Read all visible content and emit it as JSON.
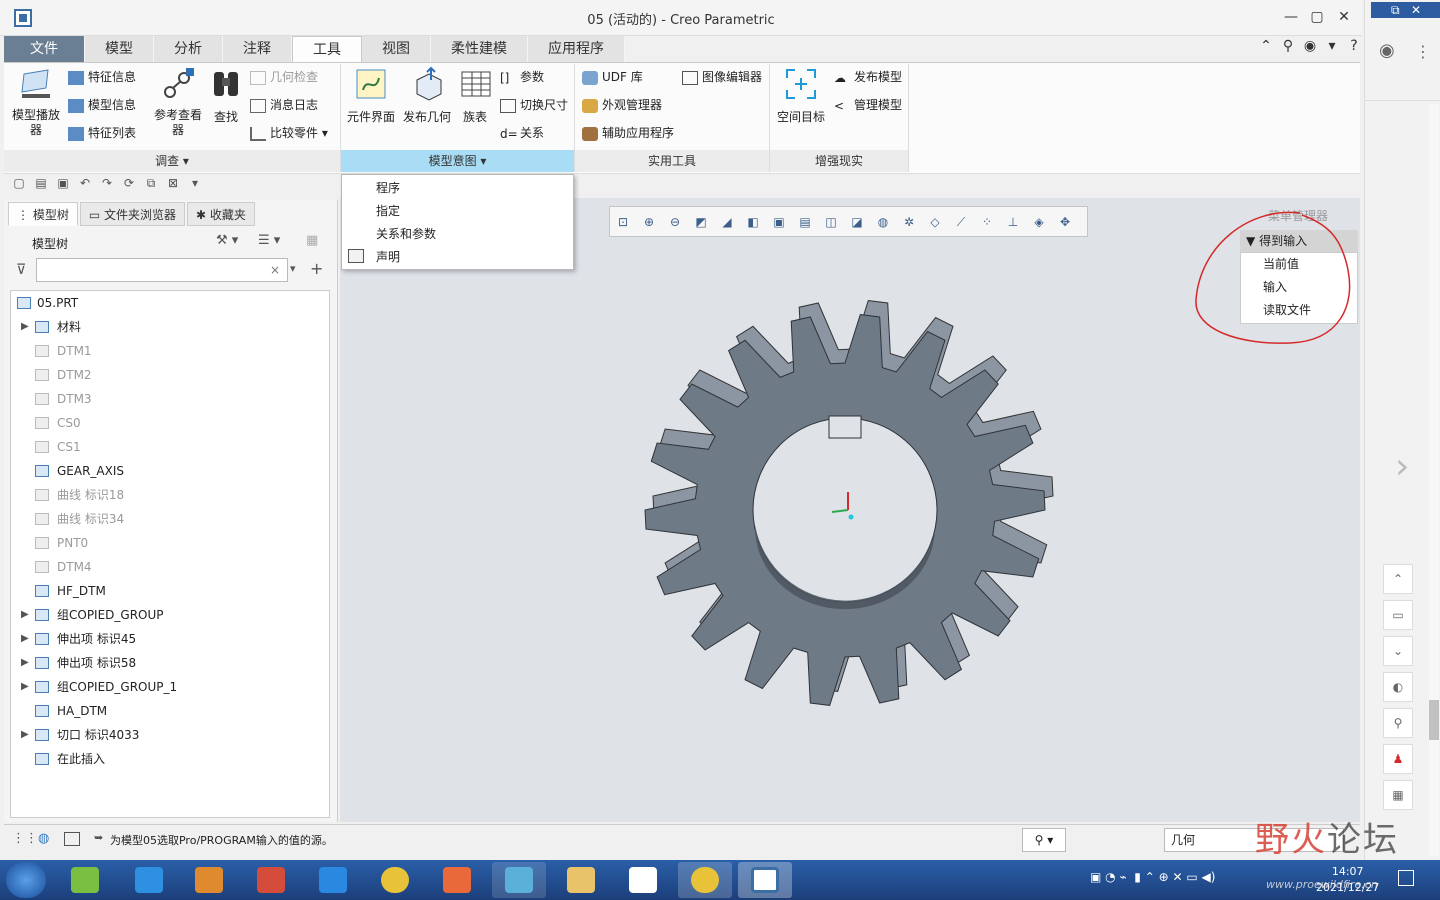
{
  "window": {
    "title": "05 (活动的) - Creo Parametric",
    "controls": [
      "minimize",
      "maximize",
      "close"
    ]
  },
  "menu_tabs": [
    "文件",
    "模型",
    "分析",
    "注释",
    "工具",
    "视图",
    "柔性建模",
    "应用程序"
  ],
  "active_tab": "工具",
  "ribbon": {
    "investigate": {
      "label": "调查",
      "big": [
        "模型播放器",
        "参考查看器",
        "查找"
      ],
      "small": [
        "特征信息",
        "模型信息",
        "特征列表",
        "几何检查",
        "消息日志",
        "比较零件"
      ]
    },
    "model_intent": {
      "label": "模型意图",
      "big": [
        "元件界面",
        "发布几何",
        "族表"
      ],
      "small": [
        "参数",
        "切换尺寸",
        "关系"
      ]
    },
    "utilities": {
      "label": "实用工具",
      "small": [
        "UDF 库",
        "外观管理器",
        "辅助应用程序",
        "图像编辑器"
      ]
    },
    "ar": {
      "label": "增强现实",
      "big": [
        "空间目标"
      ],
      "small": [
        "发布模型",
        "管理模型"
      ]
    }
  },
  "dropdown": {
    "items": [
      "程序",
      "指定",
      "关系和参数",
      "声明"
    ]
  },
  "panel_tabs": [
    "模型树",
    "文件夹浏览器",
    "收藏夹"
  ],
  "model_tree": {
    "header": "模型树",
    "filter_placeholder": "",
    "items": [
      {
        "label": "05.PRT",
        "dim": false,
        "expand": false,
        "indent": 0
      },
      {
        "label": "材料",
        "dim": false,
        "expand": true,
        "indent": 1
      },
      {
        "label": "DTM1",
        "dim": true,
        "expand": false,
        "indent": 1
      },
      {
        "label": "DTM2",
        "dim": true,
        "expand": false,
        "indent": 1
      },
      {
        "label": "DTM3",
        "dim": true,
        "expand": false,
        "indent": 1
      },
      {
        "label": "CS0",
        "dim": true,
        "expand": false,
        "indent": 1
      },
      {
        "label": "CS1",
        "dim": true,
        "expand": false,
        "indent": 1
      },
      {
        "label": "GEAR_AXIS",
        "dim": false,
        "expand": false,
        "indent": 1
      },
      {
        "label": "曲线 标识18",
        "dim": true,
        "expand": false,
        "indent": 1
      },
      {
        "label": "曲线 标识34",
        "dim": true,
        "expand": false,
        "indent": 1
      },
      {
        "label": "PNT0",
        "dim": true,
        "expand": false,
        "indent": 1
      },
      {
        "label": "DTM4",
        "dim": true,
        "expand": false,
        "indent": 1
      },
      {
        "label": "HF_DTM",
        "dim": false,
        "expand": false,
        "indent": 1
      },
      {
        "label": "组COPIED_GROUP",
        "dim": false,
        "expand": true,
        "indent": 1
      },
      {
        "label": "伸出项 标识45",
        "dim": false,
        "expand": true,
        "indent": 1
      },
      {
        "label": "伸出项 标识58",
        "dim": false,
        "expand": true,
        "indent": 1
      },
      {
        "label": "组COPIED_GROUP_1",
        "dim": false,
        "expand": true,
        "indent": 1
      },
      {
        "label": "HA_DTM",
        "dim": false,
        "expand": false,
        "indent": 1
      },
      {
        "label": "切口 标识4033",
        "dim": false,
        "expand": true,
        "indent": 1
      },
      {
        "label": "在此插入",
        "dim": false,
        "expand": false,
        "indent": 1
      }
    ]
  },
  "menu_manager": {
    "title": "菜单管理器",
    "section": "得到输入",
    "items": [
      "当前值",
      "输入",
      "读取文件"
    ]
  },
  "status": {
    "message": "为模型05选取Pro/PROGRAM输入的值的源。",
    "filter": "几何"
  },
  "taskbar": {
    "time": "14:07",
    "date": "2021/12/27"
  },
  "watermark": {
    "text1": "野火",
    "text2": "论坛",
    "url": "www.proewildfire.cn"
  },
  "colors": {
    "accent": "#a9dcf5",
    "file_tab": "#6a7f93",
    "gear": "#6f7a87",
    "annotation": "#d42a2a"
  }
}
